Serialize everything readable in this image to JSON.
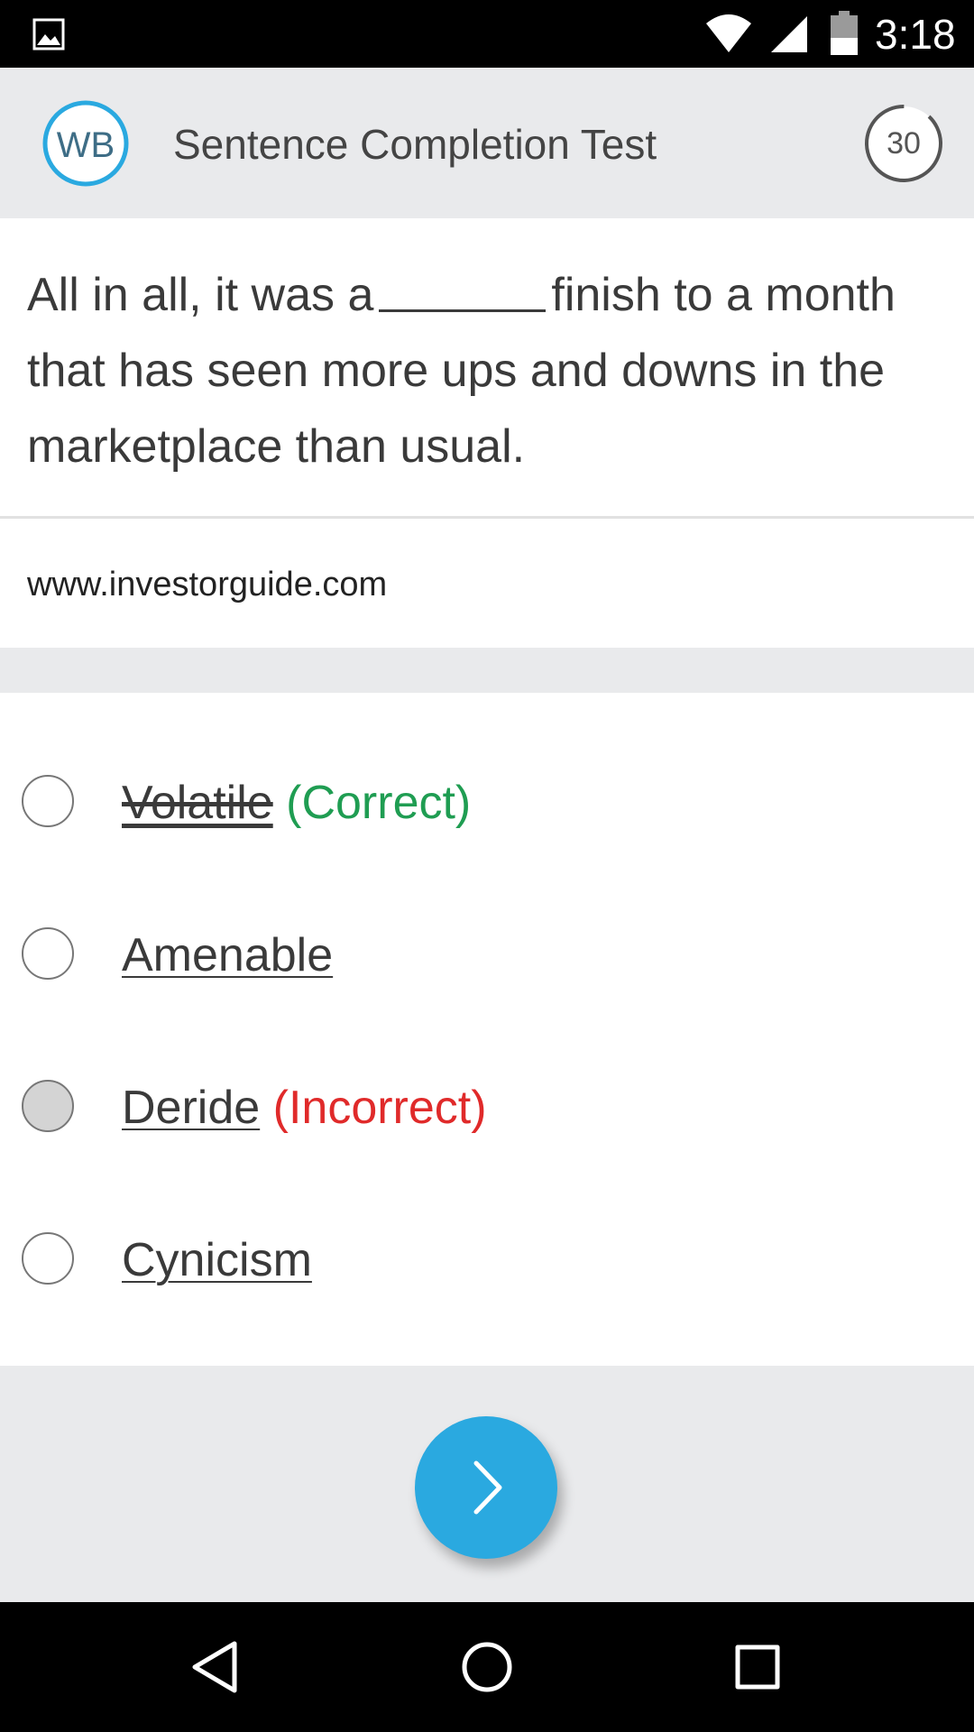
{
  "status_bar": {
    "time": "3:18",
    "icons": [
      "image-icon",
      "wifi-icon",
      "cell-signal-icon",
      "battery-icon"
    ]
  },
  "app_bar": {
    "logo_text": "WB",
    "title": "Sentence Completion Test",
    "timer_value": "30",
    "timer_remaining_fraction": 0.88
  },
  "question": {
    "text_before_blank": "All in all, it was a",
    "text_after_blank": "finish to a month that has seen more ups and downs in the marketplace than usual.",
    "source": "www.investorguide.com"
  },
  "options": [
    {
      "label": "Volatile",
      "status": "(Correct)",
      "struck": true,
      "selected": false
    },
    {
      "label": "Amenable",
      "status": "",
      "struck": false,
      "selected": false
    },
    {
      "label": "Deride",
      "status": "(Incorrect)",
      "struck": false,
      "selected": true
    },
    {
      "label": "Cynicism",
      "status": "",
      "struck": false,
      "selected": false
    }
  ],
  "footer": {
    "next_icon": "chevron-right-icon"
  },
  "nav_bar": {
    "icons": [
      "back-icon",
      "home-icon",
      "recents-icon"
    ]
  },
  "colors": {
    "accent": "#2aa9e0",
    "correct": "#1f9d52",
    "incorrect": "#e02a2a",
    "app_bar_bg": "#e9eaec"
  }
}
